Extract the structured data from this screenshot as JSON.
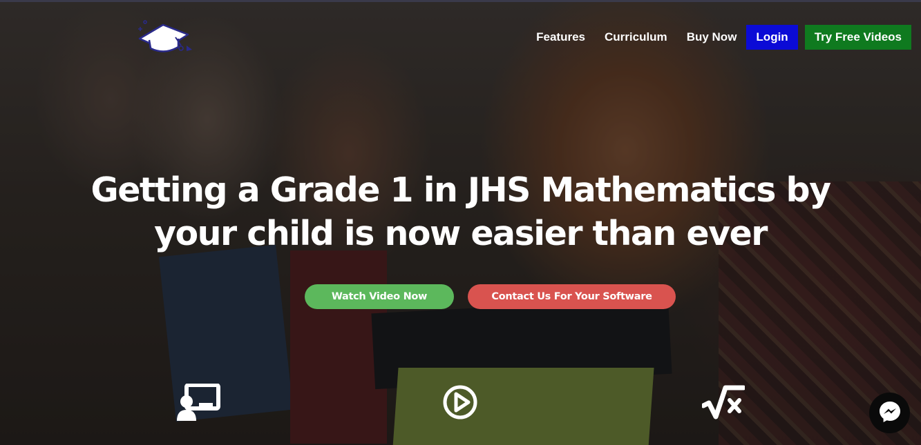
{
  "nav": {
    "links": [
      "Features",
      "Curriculum",
      "Buy Now"
    ],
    "login_label": "Login",
    "free_label": "Try Free Videos"
  },
  "hero": {
    "headline_line1": "Getting a Grade 1 in JHS Mathematics by",
    "headline_line2": "your child is now easier than ever",
    "watch_label": "Watch Video Now",
    "contact_label": "Contact Us For Your Software"
  },
  "icons": {
    "logo": "graduation-cap-logo",
    "features": [
      "classroom-teacher-icon",
      "play-circle-icon",
      "square-root-icon"
    ],
    "chat": "messenger-icon"
  },
  "colors": {
    "login": "#0b0bd6",
    "free_videos": "#0f7a1f",
    "watch": "#5cb85c",
    "contact": "#d9534f"
  }
}
